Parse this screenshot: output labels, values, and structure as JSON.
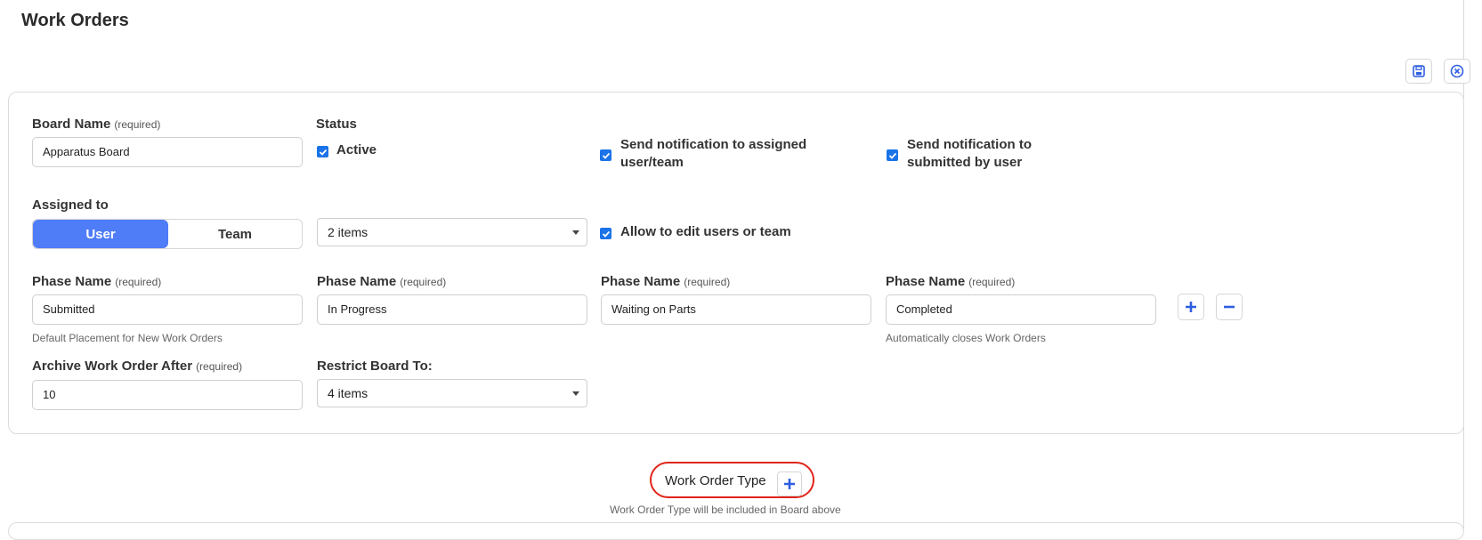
{
  "page": {
    "title": "Work Orders"
  },
  "toolbar": {
    "save_icon": "save-icon",
    "close_icon": "close-circle-icon"
  },
  "form": {
    "board_name": {
      "label": "Board Name",
      "required": "(required)",
      "value": "Apparatus Board"
    },
    "status": {
      "label": "Status",
      "active_label": "Active",
      "active_checked": true
    },
    "notify_assigned": {
      "label_line1": "Send notification to assigned",
      "label_line2": "user/team",
      "checked": true
    },
    "notify_submitter": {
      "label_line1": "Send notification to",
      "label_line2": "submitted by user",
      "checked": true
    },
    "assigned_to": {
      "label": "Assigned to",
      "options": [
        "User",
        "Team"
      ],
      "selected": "User"
    },
    "assignees_select": {
      "value": "2 items"
    },
    "allow_edit": {
      "label": "Allow to edit users or team",
      "checked": true
    },
    "phases": [
      {
        "label": "Phase Name",
        "required": "(required)",
        "value": "Submitted",
        "help": "Default Placement for New Work Orders"
      },
      {
        "label": "Phase Name",
        "required": "(required)",
        "value": "In Progress",
        "help": ""
      },
      {
        "label": "Phase Name",
        "required": "(required)",
        "value": "Waiting on Parts",
        "help": ""
      },
      {
        "label": "Phase Name",
        "required": "(required)",
        "value": "Completed",
        "help": "Automatically closes Work Orders"
      }
    ],
    "phase_add_icon": "plus-icon",
    "phase_remove_icon": "minus-icon",
    "archive": {
      "label": "Archive Work Order After",
      "required": "(required)",
      "value": "10"
    },
    "restrict": {
      "label": "Restrict Board To:",
      "value": "4 items"
    }
  },
  "work_order_type": {
    "label": "Work Order Type",
    "help": "Work Order Type will be included in Board above",
    "add_icon": "plus-icon"
  },
  "colors": {
    "accent": "#4f7cf7",
    "checkbox": "#1a73e8",
    "highlight": "#e0251b"
  }
}
